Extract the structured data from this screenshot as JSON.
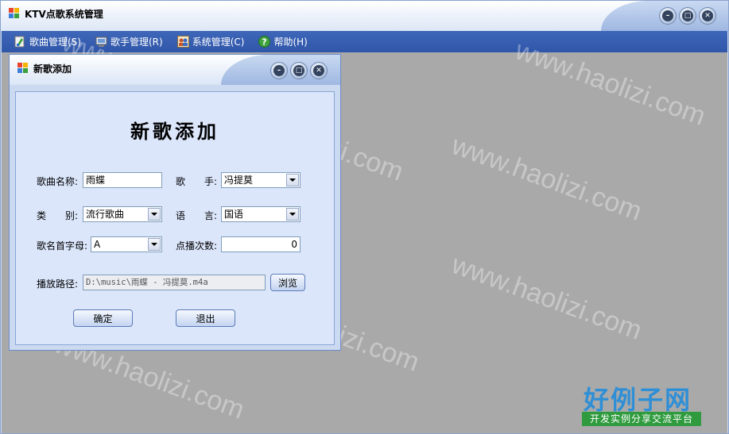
{
  "app": {
    "title": "KTV点歌系统管理"
  },
  "menu": [
    {
      "label": "歌曲管理(S)",
      "icon": "song-icon"
    },
    {
      "label": "歌手管理(R)",
      "icon": "singer-icon"
    },
    {
      "label": "系统管理(C)",
      "icon": "users-icon"
    },
    {
      "label": "帮助(H)",
      "icon": "help-icon"
    }
  ],
  "child": {
    "title": "新歌添加",
    "heading": "新歌添加",
    "fields": {
      "song_name_label": "歌曲名称:",
      "song_name_value": "雨蝶",
      "singer_label": "歌　　手:",
      "singer_value": "冯提莫",
      "type_label": "类　　别:",
      "type_value": "流行歌曲",
      "language_label": "语　　言:",
      "language_value": "国语",
      "initial_label": "歌名首字母:",
      "initial_value": "A",
      "plays_label": "点播次数:",
      "plays_value": "0",
      "path_label": "播放路径:",
      "path_value": "D:\\music\\雨蝶 - 冯提莫.m4a"
    },
    "buttons": {
      "browse": "浏览",
      "ok": "确定",
      "exit": "退出"
    }
  },
  "watermark": "www.haolizi.com",
  "logo": {
    "main": "好例子网",
    "sub": "开发实例分享交流平台"
  },
  "colors": {
    "menubar": "#3a62b4",
    "mdi_background": "#a9a9a9",
    "form_panel": "#dbe6fb",
    "logo_blue": "#2f8fd6",
    "logo_green": "#2f9b3e"
  }
}
